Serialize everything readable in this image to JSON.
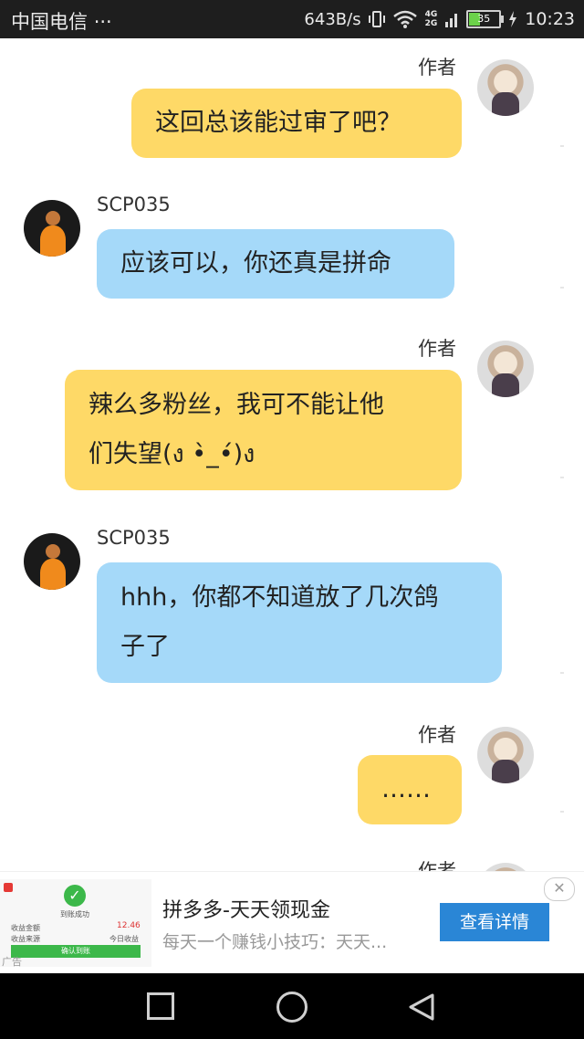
{
  "status_bar": {
    "carrier": "中国电信",
    "more": "···",
    "net_speed": "643B/s",
    "network_top": "4G",
    "network_bottom": "2G",
    "battery": "35",
    "time": "10:23"
  },
  "messages": [
    {
      "sender": "作者",
      "side": "right",
      "color": "yellow",
      "lines": [
        "这回总该能过审了吧？"
      ]
    },
    {
      "sender": "SCP035",
      "side": "left",
      "color": "blue",
      "lines": [
        "应该可以，你还真是拼命"
      ]
    },
    {
      "sender": "作者",
      "side": "right",
      "color": "yellow",
      "lines": [
        "辣么多粉丝，我可不能让他",
        "们失望(ง •̀_•́)ง"
      ]
    },
    {
      "sender": "SCP035",
      "side": "left",
      "color": "blue",
      "lines": [
        "hhh，你都不知道放了几次鸽",
        "子了"
      ]
    },
    {
      "sender": "作者",
      "side": "right",
      "color": "yellow",
      "lines": [
        "……"
      ]
    },
    {
      "sender": "作者",
      "side": "right",
      "color": "yellow",
      "lines": []
    }
  ],
  "ad": {
    "thumb_title": "到账成功",
    "thumb_label1": "收益金额",
    "thumb_amount": "12.46",
    "thumb_label2": "收益来源",
    "thumb_source": "今日收益",
    "thumb_button": "确认到账",
    "tag": "广告",
    "title": "拼多多-天天领现金",
    "description": "每天一个赚钱小技巧：天天...",
    "cta": "查看详情",
    "close": "✕"
  },
  "colors": {
    "author_bubble": "#fed967",
    "scp_bubble": "#a5d9f9",
    "cta": "#2a86d6"
  }
}
